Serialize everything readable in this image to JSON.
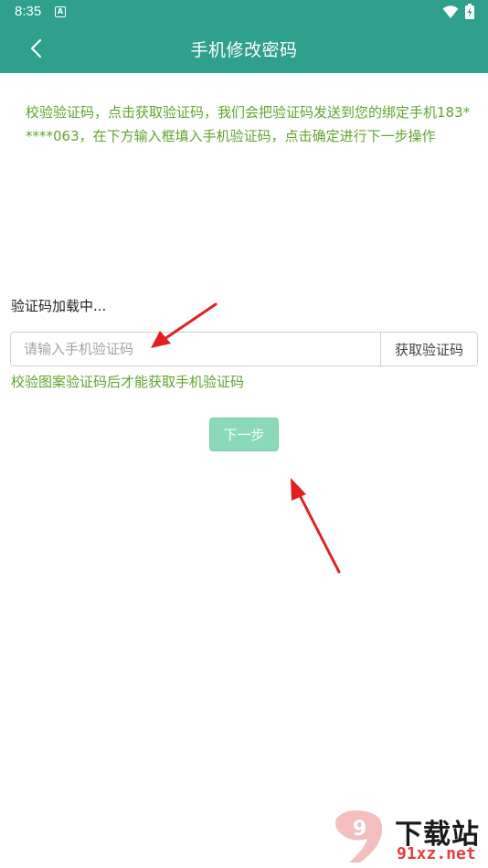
{
  "status_bar": {
    "time": "8:35",
    "app_icon_glyph": "A",
    "icons": [
      "app-notification-icon",
      "wifi-icon",
      "battery-charging-icon"
    ]
  },
  "app_bar": {
    "back_icon": "chevron-left-icon",
    "title": "手机修改密码",
    "background_color": "#2ea08c"
  },
  "instruction": {
    "text": "校验验证码，点击获取验证码，我们会把验证码发送到您的绑定手机183*****063，在下方输入框填入手机验证码，点击确定进行下一步操作",
    "color": "#5fa52c"
  },
  "captcha": {
    "loading_text": "验证码加载中..."
  },
  "code_field": {
    "value": "",
    "placeholder": "请输入手机验证码",
    "get_code_label": "获取验证码"
  },
  "hint": {
    "text": "校验图案验证码后才能获取手机验证码"
  },
  "next_button": {
    "label": "下一步",
    "color": "#8ad9b9"
  },
  "annotations": {
    "arrow_color": "#e02020"
  },
  "watermark": {
    "logo_glyph": "9",
    "title": "下载站",
    "domain": "91xz.net"
  }
}
